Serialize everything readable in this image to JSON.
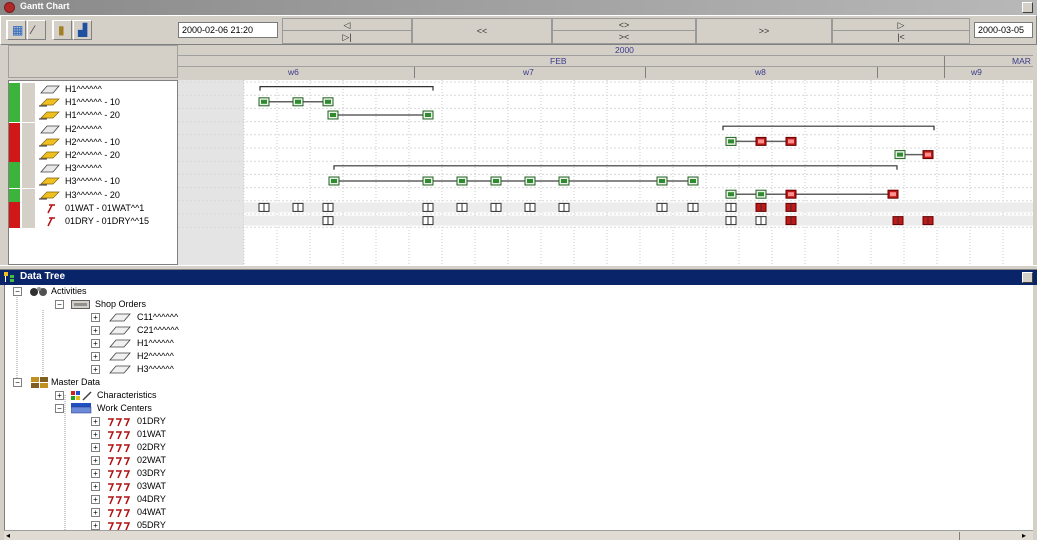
{
  "window": {
    "title": "Gantt Chart"
  },
  "toolbar": {
    "buttons": [
      {
        "name": "display-settings-icon",
        "glyph": "▦"
      },
      {
        "name": "edit-icon",
        "glyph": "⁄"
      },
      {
        "name": "trash-icon",
        "glyph": "▮"
      },
      {
        "name": "chart-config-icon",
        "glyph": "▟"
      }
    ],
    "date_start": "2000-02-06 21:20",
    "date_end": "2000-03-05",
    "nav": {
      "first_top": "◁",
      "first_bottom": "▷|",
      "back": "<<",
      "zoom_in": "<>",
      "zoom_out": "><",
      "forward": ">>",
      "last_top": "▷",
      "last_bottom": "|<"
    }
  },
  "timescale": {
    "year": "2000",
    "months": [
      "FEB",
      "MAR"
    ],
    "weeks": [
      "w6",
      "w7",
      "w8",
      "w9"
    ]
  },
  "rows": [
    {
      "label": "H1^^^^^^",
      "color": "#3cb43c",
      "icon": "activity"
    },
    {
      "label": "H1^^^^^^ - 10",
      "color": "#3cb43c",
      "icon": "operation"
    },
    {
      "label": "H1^^^^^^ - 20",
      "color": "#3cb43c",
      "icon": "operation"
    },
    {
      "label": "H2^^^^^^",
      "color": "#d01818",
      "icon": "activity"
    },
    {
      "label": "H2^^^^^^ - 10",
      "color": "#d01818",
      "icon": "operation"
    },
    {
      "label": "H2^^^^^^ - 20",
      "color": "#d01818",
      "icon": "operation"
    },
    {
      "label": "H3^^^^^^",
      "color": "#3cb43c",
      "icon": "activity"
    },
    {
      "label": "H3^^^^^^ - 10",
      "color": "#3cb43c",
      "icon": "operation"
    },
    {
      "label": "H3^^^^^^ - 20",
      "color": "#3cb43c",
      "icon": "operation"
    },
    {
      "label": "01WAT - 01WAT^^1",
      "color": "#d01818",
      "icon": "workcenter"
    },
    {
      "label": "01DRY - 01DRY^^15",
      "color": "#d01818",
      "icon": "workcenter"
    }
  ],
  "data_tree": {
    "title": "Data Tree",
    "activities_label": "Activities",
    "shop_orders_label": "Shop Orders",
    "shop_orders": [
      "C11^^^^^^",
      "C21^^^^^^",
      "H1^^^^^^",
      "H2^^^^^^",
      "H3^^^^^^"
    ],
    "master_data_label": "Master Data",
    "characteristics_label": "Characteristics",
    "work_centers_label": "Work Centers",
    "work_centers": [
      "01DRY",
      "01WAT",
      "02DRY",
      "02WAT",
      "03DRY",
      "03WAT",
      "04DRY",
      "04WAT",
      "05DRY"
    ]
  },
  "colors": {
    "title_bar": "#0a246a",
    "status_green": "#3cb43c",
    "status_red": "#d01818",
    "bar_fill": "#2e8b2e",
    "bar_late": "#c01818",
    "header_text": "#3a3a8a"
  }
}
